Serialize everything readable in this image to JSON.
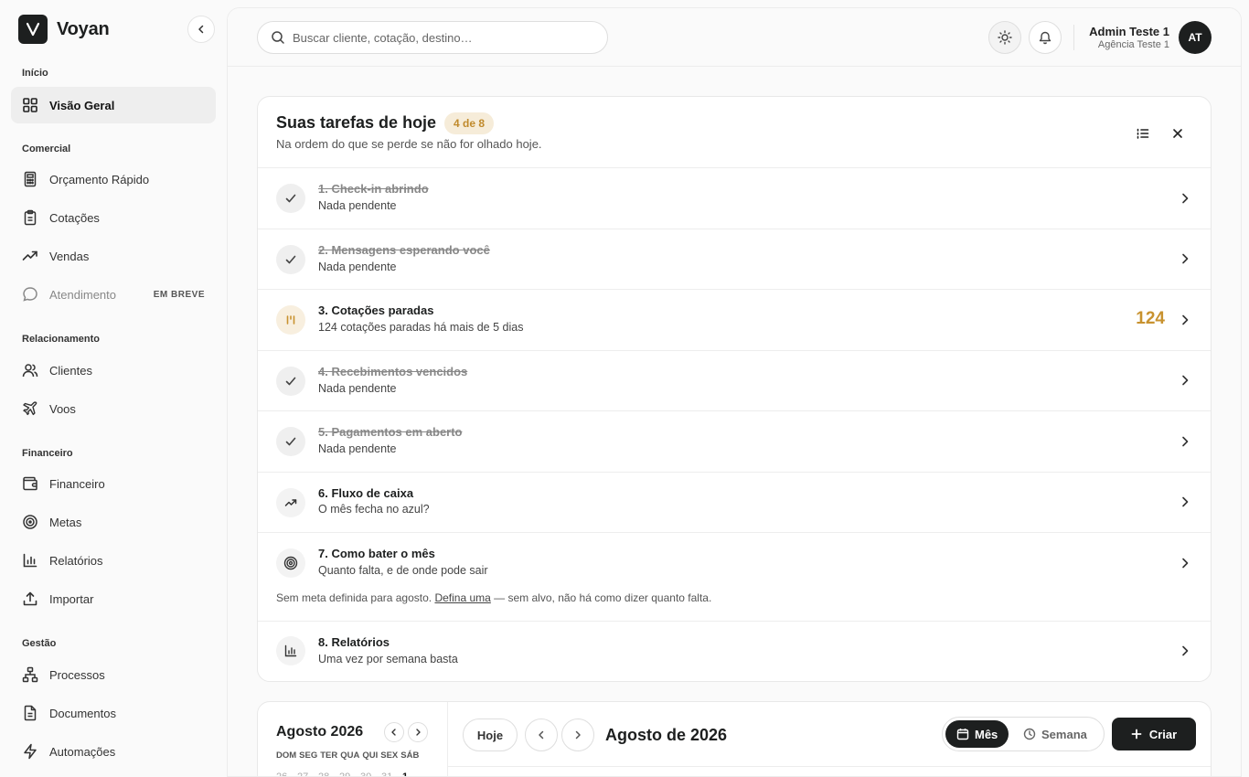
{
  "brand": {
    "name": "Voyan"
  },
  "sidebar": {
    "sections": {
      "inicio": "Início",
      "comercial": "Comercial",
      "relacionamento": "Relacionamento",
      "financeiro": "Financeiro",
      "gestao": "Gestão"
    },
    "items": {
      "visao_geral": "Visão Geral",
      "orcamento": "Orçamento Rápido",
      "cotacoes": "Cotações",
      "vendas": "Vendas",
      "atendimento": "Atendimento",
      "atendimento_badge": "EM BREVE",
      "clientes": "Clientes",
      "voos": "Voos",
      "financeiro": "Financeiro",
      "metas": "Metas",
      "relatorios": "Relatórios",
      "importar": "Importar",
      "processos": "Processos",
      "documentos": "Documentos",
      "automacoes": "Automações"
    }
  },
  "header": {
    "search_placeholder": "Buscar cliente, cotação, destino…",
    "user_name": "Admin Teste 1",
    "user_agency": "Agência Teste 1",
    "avatar_initials": "AT"
  },
  "tasks": {
    "title": "Suas tarefas de hoje",
    "badge": "4 de 8",
    "subtitle": "Na ordem do que se perde se não for olhado hoje.",
    "items": [
      {
        "title": "1. Check-in abrindo",
        "desc": "Nada pendente"
      },
      {
        "title": "2. Mensagens esperando você",
        "desc": "Nada pendente"
      },
      {
        "title": "3. Cotações paradas",
        "desc": "124 cotações paradas há mais de 5 dias",
        "count": "124"
      },
      {
        "title": "4. Recebimentos vencidos",
        "desc": "Nada pendente"
      },
      {
        "title": "5. Pagamentos em aberto",
        "desc": "Nada pendente"
      },
      {
        "title": "6. Fluxo de caixa",
        "desc": "O mês fecha no azul?"
      },
      {
        "title": "7. Como bater o mês",
        "desc": "Quanto falta, e de onde pode sair"
      },
      {
        "title": "8. Relatórios",
        "desc": "Uma vez por semana basta"
      }
    ],
    "goal_note_before": "Sem meta definida para agosto.",
    "goal_note_link": "Defina uma",
    "goal_note_after": "— sem alvo, não há como dizer quanto falta."
  },
  "calendar": {
    "mini_title": "Agosto 2026",
    "weekdays": [
      "DOM",
      "SEG",
      "TER",
      "QUA",
      "QUI",
      "SEX",
      "SÁB"
    ],
    "first_row": [
      "26",
      "27",
      "28",
      "29",
      "30",
      "31",
      "1"
    ],
    "today_label": "Hoje",
    "main_title": "Agosto de 2026",
    "view_month": "Mês",
    "view_week": "Semana",
    "create_label": "Criar"
  }
}
